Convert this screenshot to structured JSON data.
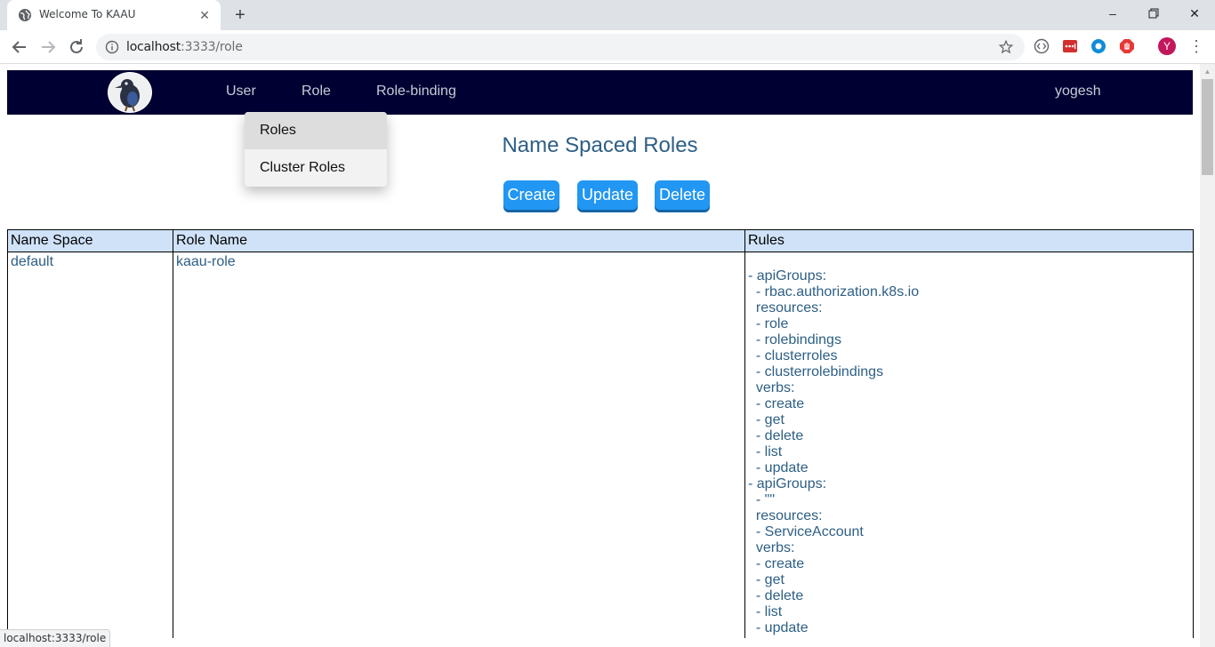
{
  "browser": {
    "tab_title": "Welcome To KAAU",
    "url_host": "localhost",
    "url_path": ":3333/role",
    "profile_initial": "Y",
    "status_url": "localhost:3333/role"
  },
  "navbar": {
    "links": [
      "User",
      "Role",
      "Role-binding"
    ],
    "username": "yogesh"
  },
  "role_dropdown": {
    "items": [
      "Roles",
      "Cluster Roles"
    ],
    "highlighted": "Roles"
  },
  "page": {
    "title": "Name Spaced Roles",
    "buttons": {
      "create": "Create",
      "update": "Update",
      "delete": "Delete"
    }
  },
  "table": {
    "headers": [
      "Name Space",
      "Role Name",
      "Rules"
    ],
    "rows": [
      {
        "namespace": "default",
        "role_name": "kaau-role",
        "rules": "- apiGroups:\n  - rbac.authorization.k8s.io\n  resources:\n  - role\n  - rolebindings\n  - clusterroles\n  - clusterrolebindings\n  verbs:\n  - create\n  - get\n  - delete\n  - list\n  - update\n- apiGroups:\n  - \"\"\n  resources:\n  - ServiceAccount\n  verbs:\n  - create\n  - get\n  - delete\n  - list\n  - update"
      }
    ]
  },
  "colors": {
    "navbar_bg": "#000033",
    "accent_button": "#2196f3",
    "header_row_bg": "#cfe2f8",
    "text_blue": "#2d5f85"
  }
}
